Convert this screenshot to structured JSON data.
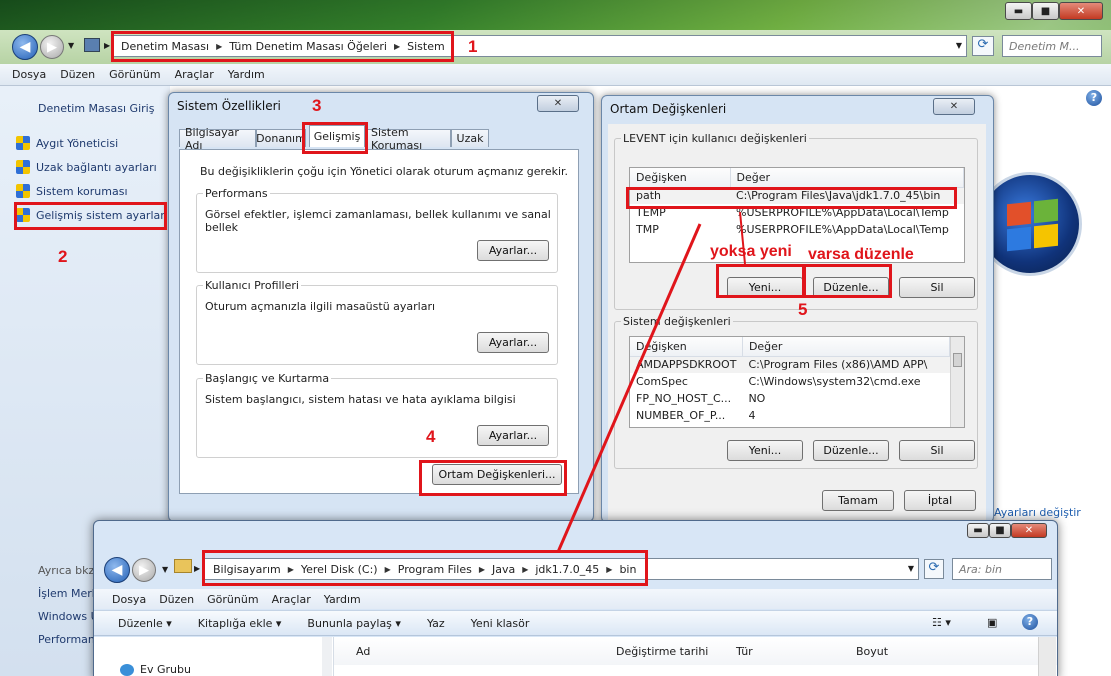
{
  "window": {
    "controls": [
      "▬",
      "■",
      "✕"
    ],
    "breadcrumb": [
      "Denetim Masası",
      "Tüm Denetim Masası Öğeleri",
      "Sistem"
    ],
    "search_placeholder": "Denetim M...",
    "menu": [
      "Dosya",
      "Düzen",
      "Görünüm",
      "Araçlar",
      "Yardım"
    ],
    "help_icon": "?"
  },
  "sidebar": {
    "home": "Denetim Masası Giriş",
    "links": [
      "Aygıt Yöneticisi",
      "Uzak bağlantı ayarları",
      "Sistem koruması",
      "Gelişmiş sistem ayarları"
    ],
    "also_see": "Ayrıca bkz",
    "also_items": [
      "İşlem Merk",
      "Windows U",
      "Performan"
    ]
  },
  "content_right_link": "Ayarları değiştir",
  "system_props": {
    "title": "Sistem Özellikleri",
    "tabs": [
      "Bilgisayar Adı",
      "Donanım",
      "Gelişmiş",
      "Sistem Koruması",
      "Uzak"
    ],
    "active_tab": "Gelişmiş",
    "intro": "Bu değişikliklerin çoğu için Yönetici olarak oturum açmanız gerekir.",
    "groups": [
      {
        "label": "Performans",
        "desc": "Görsel efektler, işlemci zamanlaması, bellek kullanımı ve sanal bellek",
        "button": "Ayarlar..."
      },
      {
        "label": "Kullanıcı Profilleri",
        "desc": "Oturum açmanızla ilgili masaüstü ayarları",
        "button": "Ayarlar..."
      },
      {
        "label": "Başlangıç ve Kurtarma",
        "desc": "Sistem başlangıcı, sistem hatası ve hata ayıklama bilgisi",
        "button": "Ayarlar..."
      }
    ],
    "env_button": "Ortam Değişkenleri..."
  },
  "env_vars": {
    "title": "Ortam Değişkenleri",
    "user_section": "LEVENT için kullanıcı değişkenleri",
    "columns": [
      "Değişken",
      "Değer"
    ],
    "user_rows": [
      [
        "path",
        "C:\\Program Files\\Java\\jdk1.7.0_45\\bin"
      ],
      [
        "TEMP",
        "%USERPROFILE%\\AppData\\Local\\Temp"
      ],
      [
        "TMP",
        "%USERPROFILE%\\AppData\\Local\\Temp"
      ]
    ],
    "user_buttons": [
      "Yeni...",
      "Düzenle...",
      "Sil"
    ],
    "system_section": "Sistem değişkenleri",
    "system_rows": [
      [
        "AMDAPPSDKROOT",
        "C:\\Program Files (x86)\\AMD APP\\"
      ],
      [
        "ComSpec",
        "C:\\Windows\\system32\\cmd.exe"
      ],
      [
        "FP_NO_HOST_C...",
        "NO"
      ],
      [
        "NUMBER_OF_P...",
        "4"
      ]
    ],
    "system_buttons": [
      "Yeni...",
      "Düzenle...",
      "Sil"
    ],
    "ok": "Tamam",
    "cancel": "İptal"
  },
  "explorer": {
    "breadcrumb": [
      "Bilgisayarım",
      "Yerel Disk (C:)",
      "Program Files",
      "Java",
      "jdk1.7.0_45",
      "bin"
    ],
    "search_placeholder": "Ara: bin",
    "menu": [
      "Dosya",
      "Düzen",
      "Görünüm",
      "Araçlar",
      "Yardım"
    ],
    "toolbar": [
      "Düzenle ▾",
      "Kitaplığa ekle ▾",
      "Bununla paylaş ▾",
      "Yaz",
      "Yeni klasör"
    ],
    "nav_item": "Ev Grubu",
    "columns": [
      "Ad",
      "Değiştirme tarihi",
      "Tür",
      "Boyut"
    ]
  },
  "annotations": {
    "numbers": [
      "1",
      "2",
      "3",
      "4",
      "5"
    ],
    "yoksa": "yoksa yeni",
    "varsa": "varsa düzenle",
    "color": "#e0151b"
  }
}
